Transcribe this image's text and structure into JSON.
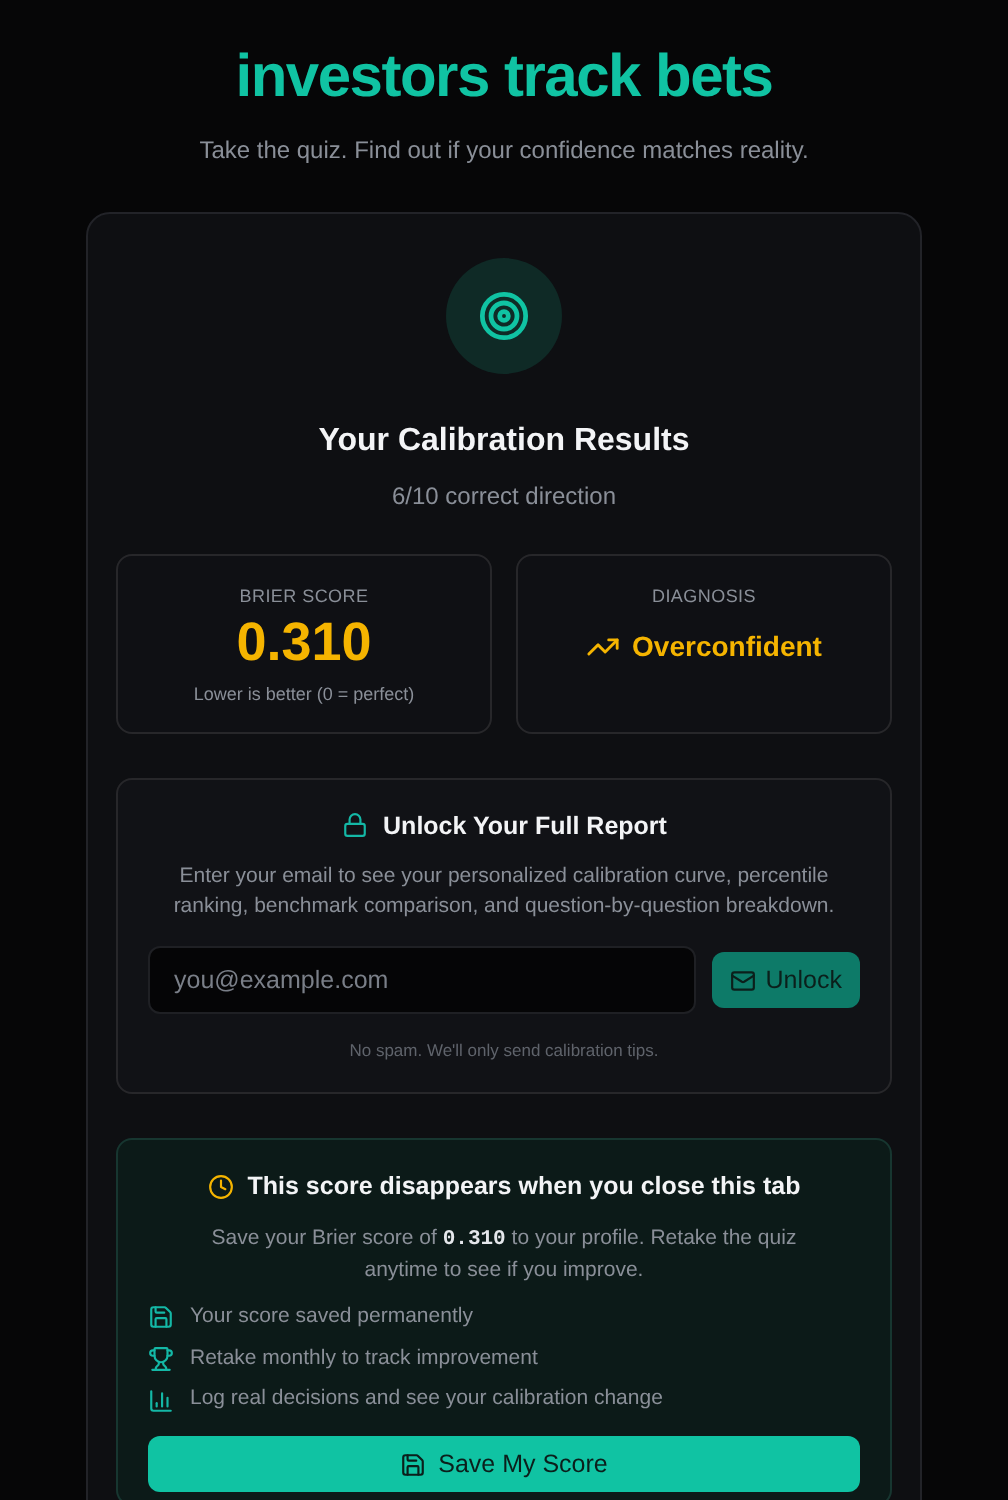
{
  "hero": {
    "headline_accent": "investors track bets",
    "subtitle": "Take the quiz. Find out if your confidence matches reality."
  },
  "results": {
    "title": "Your Calibration Results",
    "summary": "6/10 correct direction",
    "stats": [
      {
        "kind": "score",
        "label": "BRIER SCORE",
        "value": "0.310",
        "note": "Lower is better (0 = perfect)"
      },
      {
        "kind": "diagnosis",
        "label": "DIAGNOSIS",
        "value": "Overconfident"
      }
    ]
  },
  "unlock": {
    "title": "Unlock Your Full Report",
    "description": "Enter your email to see your personalized calibration curve, percentile ranking, benchmark comparison, and question-by-question breakdown.",
    "email_placeholder": "you@example.com",
    "button": "Unlock",
    "fine_print": "No spam. We'll only send calibration tips."
  },
  "save": {
    "title": "This score disappears when you close this tab",
    "description_before": "Save your Brier score of ",
    "score": "0.310",
    "description_after": " to your profile. Retake the quiz anytime to see if you improve.",
    "benefits": [
      {
        "kind": "save",
        "text": "Your score saved permanently"
      },
      {
        "kind": "trophy",
        "text": "Retake monthly to track improvement"
      },
      {
        "kind": "chart",
        "text": "Log real decisions and see your calibration change"
      }
    ],
    "button": "Save My Score"
  }
}
